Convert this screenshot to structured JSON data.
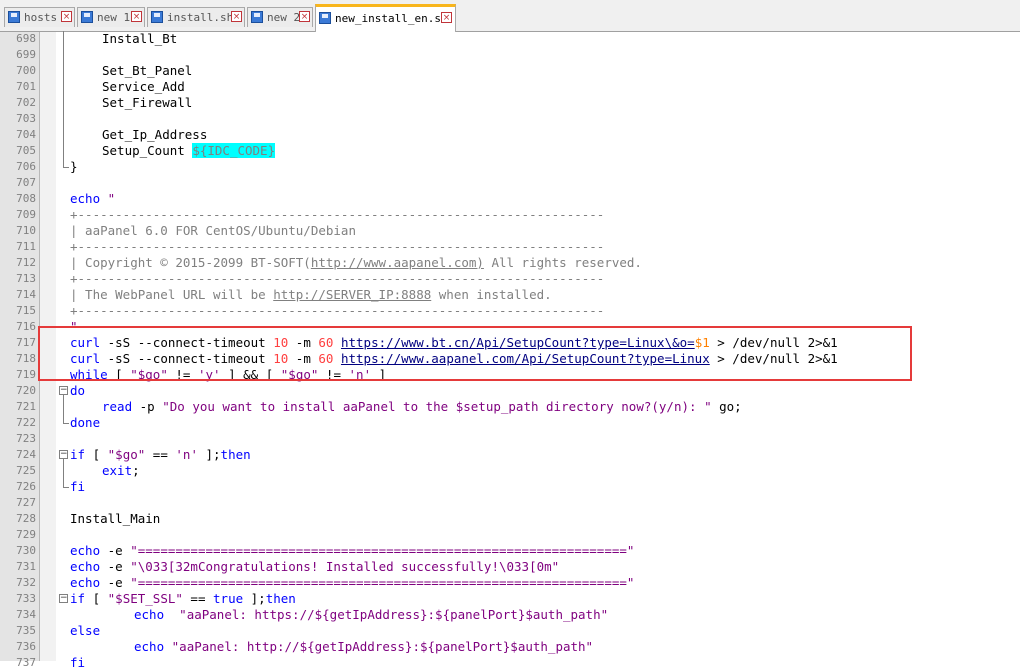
{
  "tabs": [
    {
      "label": "hosts"
    },
    {
      "label": "new 1"
    },
    {
      "label": "install.sh"
    },
    {
      "label": "new 2"
    },
    {
      "label": "new_install_en.sh",
      "active": true
    }
  ],
  "lines": [
    {
      "n": "698",
      "indent": 1,
      "segs": [
        [
          "Install_Bt",
          ""
        ]
      ]
    },
    {
      "n": "699",
      "segs": []
    },
    {
      "n": "700",
      "indent": 1,
      "segs": [
        [
          "Set_Bt_Panel",
          ""
        ]
      ]
    },
    {
      "n": "701",
      "indent": 1,
      "segs": [
        [
          "Service_Add",
          ""
        ]
      ]
    },
    {
      "n": "702",
      "indent": 1,
      "segs": [
        [
          "Set_Firewall",
          ""
        ]
      ]
    },
    {
      "n": "703",
      "segs": []
    },
    {
      "n": "704",
      "indent": 1,
      "segs": [
        [
          "Get_Ip_Address",
          ""
        ]
      ]
    },
    {
      "n": "705",
      "indent": 1,
      "segs": [
        [
          "Setup_Count ",
          ""
        ],
        [
          "${IDC_CODE}",
          "hl"
        ]
      ]
    },
    {
      "n": "706",
      "fold": "end",
      "segs": [
        [
          "}",
          ""
        ]
      ]
    },
    {
      "n": "707",
      "segs": []
    },
    {
      "n": "708",
      "segs": [
        [
          "echo",
          "kw"
        ],
        [
          " \"",
          "str"
        ]
      ]
    },
    {
      "n": "709",
      "segs": [
        [
          "+----------------------------------------------------------------------",
          "cmt"
        ]
      ]
    },
    {
      "n": "710",
      "segs": [
        [
          "| aaPanel 6.0 FOR CentOS/Ubuntu/Debian",
          "cmt"
        ]
      ]
    },
    {
      "n": "711",
      "segs": [
        [
          "+----------------------------------------------------------------------",
          "cmt"
        ]
      ]
    },
    {
      "n": "712",
      "segs": [
        [
          "| Copyright © 2015-2099 BT-SOFT(",
          "cmt"
        ],
        [
          "http://www.aapanel.com)",
          "cmt url"
        ],
        [
          " All rights reserved.",
          "cmt"
        ]
      ]
    },
    {
      "n": "713",
      "segs": [
        [
          "+----------------------------------------------------------------------",
          "cmt"
        ]
      ]
    },
    {
      "n": "714",
      "segs": [
        [
          "| The WebPanel URL will be ",
          "cmt"
        ],
        [
          "http://SERVER_IP:8888",
          "cmt url"
        ],
        [
          " when installed.",
          "cmt"
        ]
      ]
    },
    {
      "n": "715",
      "segs": [
        [
          "+----------------------------------------------------------------------",
          "cmt"
        ]
      ]
    },
    {
      "n": "716",
      "segs": [
        [
          "\"",
          "str"
        ]
      ]
    },
    {
      "n": "717",
      "segs": [
        [
          "curl",
          "kw"
        ],
        [
          " -sS --connect-timeout ",
          ""
        ],
        [
          "10",
          "num"
        ],
        [
          " -m ",
          ""
        ],
        [
          "60",
          "num"
        ],
        [
          " ",
          ""
        ],
        [
          "https://www.bt.cn/Api/SetupCount?type=Linux\\&o=",
          "url"
        ],
        [
          "$1",
          "var"
        ],
        [
          " > /dev/null ",
          ""
        ],
        [
          "2",
          ""
        ],
        [
          ">&1",
          ""
        ]
      ]
    },
    {
      "n": "718",
      "segs": [
        [
          "curl",
          "kw"
        ],
        [
          " -sS --connect-timeout ",
          ""
        ],
        [
          "10",
          "num"
        ],
        [
          " -m ",
          ""
        ],
        [
          "60",
          "num"
        ],
        [
          " ",
          ""
        ],
        [
          "https://www.aapanel.com/Api/SetupCount?type=Linux",
          "url"
        ],
        [
          " > /dev/null ",
          ""
        ],
        [
          "2",
          ""
        ],
        [
          ">&1",
          ""
        ]
      ]
    },
    {
      "n": "719",
      "segs": [
        [
          "while",
          "kw"
        ],
        [
          " [ ",
          ""
        ],
        [
          "\"$go\"",
          "str"
        ],
        [
          " != ",
          ""
        ],
        [
          "'y'",
          "str"
        ],
        [
          " ] && [ ",
          ""
        ],
        [
          "\"$go\"",
          "str"
        ],
        [
          " != ",
          ""
        ],
        [
          "'n'",
          "str"
        ],
        [
          " ]",
          ""
        ]
      ]
    },
    {
      "n": "720",
      "fold": "start",
      "segs": [
        [
          "do",
          "kw"
        ]
      ]
    },
    {
      "n": "721",
      "indent": 1,
      "segs": [
        [
          "read",
          "kw"
        ],
        [
          " -p ",
          ""
        ],
        [
          "\"Do you want to install aaPanel to the $setup_path directory now?(y/n): \"",
          "str"
        ],
        [
          " go;",
          ""
        ]
      ]
    },
    {
      "n": "722",
      "fold": "end",
      "segs": [
        [
          "done",
          "kw"
        ]
      ]
    },
    {
      "n": "723",
      "segs": []
    },
    {
      "n": "724",
      "fold": "start",
      "segs": [
        [
          "if",
          "kw"
        ],
        [
          " [ ",
          ""
        ],
        [
          "\"$go\"",
          "str"
        ],
        [
          " == ",
          ""
        ],
        [
          "'n'",
          "str"
        ],
        [
          " ];",
          ""
        ],
        [
          "then",
          "kw"
        ]
      ]
    },
    {
      "n": "725",
      "indent": 1,
      "segs": [
        [
          "exit",
          "kw"
        ],
        [
          ";",
          ""
        ]
      ]
    },
    {
      "n": "726",
      "fold": "end",
      "segs": [
        [
          "fi",
          "kw"
        ]
      ]
    },
    {
      "n": "727",
      "segs": []
    },
    {
      "n": "728",
      "segs": [
        [
          "Install_Main",
          ""
        ]
      ]
    },
    {
      "n": "729",
      "segs": []
    },
    {
      "n": "730",
      "segs": [
        [
          "echo",
          "kw"
        ],
        [
          " -e ",
          ""
        ],
        [
          "\"=================================================================\"",
          "str"
        ]
      ]
    },
    {
      "n": "731",
      "segs": [
        [
          "echo",
          "kw"
        ],
        [
          " -e ",
          ""
        ],
        [
          "\"\\033[32mCongratulations! Installed successfully!\\033[0m\"",
          "str"
        ]
      ]
    },
    {
      "n": "732",
      "segs": [
        [
          "echo",
          "kw"
        ],
        [
          " -e ",
          ""
        ],
        [
          "\"=================================================================\"",
          "str"
        ]
      ]
    },
    {
      "n": "733",
      "fold": "start",
      "segs": [
        [
          "if",
          "kw"
        ],
        [
          " [ ",
          ""
        ],
        [
          "\"$SET_SSL\"",
          "str"
        ],
        [
          " == ",
          ""
        ],
        [
          "true",
          "kw"
        ],
        [
          " ];",
          ""
        ],
        [
          "then",
          "kw"
        ]
      ]
    },
    {
      "n": "734",
      "indent": 2,
      "segs": [
        [
          "echo",
          "kw"
        ],
        [
          "  ",
          ""
        ],
        [
          "\"aaPanel: https://${getIpAddress}:${panelPort}$auth_path\"",
          "str"
        ]
      ]
    },
    {
      "n": "735",
      "segs": [
        [
          "else",
          "kw"
        ]
      ]
    },
    {
      "n": "736",
      "indent": 2,
      "segs": [
        [
          "echo",
          "kw"
        ],
        [
          " ",
          ""
        ],
        [
          "\"aaPanel: http://${getIpAddress}:${panelPort}$auth_path\"",
          "str"
        ]
      ]
    },
    {
      "n": "737",
      "segs": [
        [
          "fi",
          "kw"
        ]
      ]
    }
  ]
}
